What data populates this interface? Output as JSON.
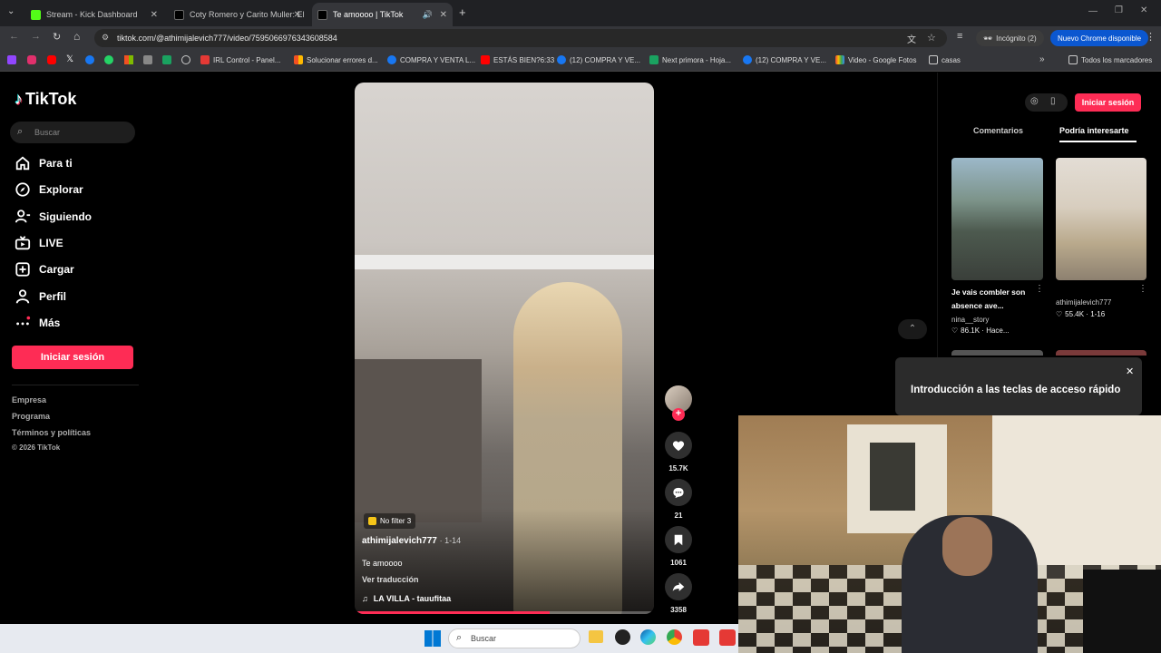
{
  "browser": {
    "tabs": [
      {
        "title": "Stream - Kick Dashboard"
      },
      {
        "title": "Coty Romero y Carito Muller: El"
      },
      {
        "title": "Te amoooo | TikTok"
      }
    ],
    "url": "tiktok.com/@athimijalevich777/video/7595066976343608584",
    "incognito_label": "Incógnito (2)",
    "update_label": "Nuevo Chrome disponible",
    "bookmarks": [
      "IRL Control - Panel...",
      "Solucionar errores d...",
      "COMPRA Y VENTA L...",
      "ESTÁS BIEN?6:33",
      "(12) COMPRA Y VE...",
      "Next primora - Hoja...",
      "(12) COMPRA Y VE...",
      "Video - Google Fotos",
      "casas"
    ],
    "all_bookmarks": "Todos los marcadores"
  },
  "tiktok": {
    "logo": "TikTok",
    "search_placeholder": "Buscar",
    "nav": [
      "Para ti",
      "Explorar",
      "Siguiendo",
      "LIVE",
      "Cargar",
      "Perfil",
      "Más"
    ],
    "login_button": "Iniciar sesión",
    "footer": [
      "Empresa",
      "Programa",
      "Términos y políticas",
      "© 2026 TikTok"
    ],
    "video": {
      "tag": "No filter 3",
      "author": "athimijalevich777",
      "date": "· 1-14",
      "caption": "Te amoooo",
      "translate": "Ver traducción",
      "music": "LA VILLA - tauufitaa"
    },
    "actions": {
      "likes": "15.7K",
      "comments": "21",
      "saves": "1061",
      "shares": "3358"
    },
    "right_panel": {
      "login": "Iniciar sesión",
      "tabs": [
        "Comentarios",
        "Podría interesarte"
      ],
      "cards": [
        {
          "title": "Je vais combler son absence ave...",
          "author": "nina__story",
          "stats": "86.1K · Hace..."
        },
        {
          "title": "",
          "author": "athimijalevich777",
          "stats": "55.4K · 1-16"
        }
      ],
      "shortcut_popup": "Introducción a las teclas de acceso rápido"
    }
  },
  "taskbar": {
    "search": "Buscar"
  }
}
